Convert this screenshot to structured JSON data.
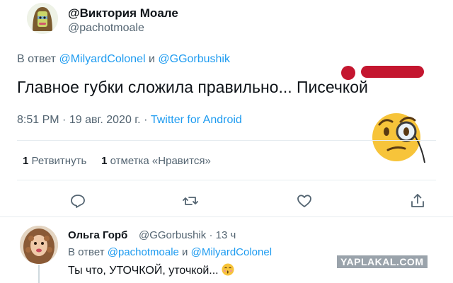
{
  "tweet": {
    "display_name": "@Виктория Моале",
    "handle": "@pachotmoale",
    "reply_prefix": "В ответ",
    "reply_to_1": "@MilyardColonel",
    "reply_joiner": "и",
    "reply_to_2": "@GGorbushik",
    "text": "Главное губки сложила правильно... Писечкой",
    "time": "8:51 PM",
    "date": "19 авг. 2020 г.",
    "separator": "·",
    "source": "Twitter for Android",
    "retweets_count": "1",
    "retweets_label": "Ретвитнуть",
    "likes_count": "1",
    "likes_label": "отметка «Нравится»"
  },
  "reply": {
    "display_name": "Ольга Горб",
    "handle": "@GGorbushik",
    "separator": "·",
    "age": "13 ч",
    "reply_prefix": "В ответ",
    "reply_to_1": "@pachotmoale",
    "reply_joiner": "и",
    "reply_to_2": "@MilyardColonel",
    "text": "Ты что, УТОЧКОЙ, уточкой..."
  },
  "icons": {
    "reply": "reply-icon",
    "retweet": "retweet-icon",
    "like": "heart-icon",
    "share": "share-icon",
    "emoji": "monocle-face-emoji",
    "reply_emoji": "kissing-face-emoji"
  },
  "watermark": "YAPLAKAL.COM",
  "colors": {
    "link": "#1d9bf0",
    "secondary_text": "#536471",
    "redaction": "#c4162f"
  }
}
